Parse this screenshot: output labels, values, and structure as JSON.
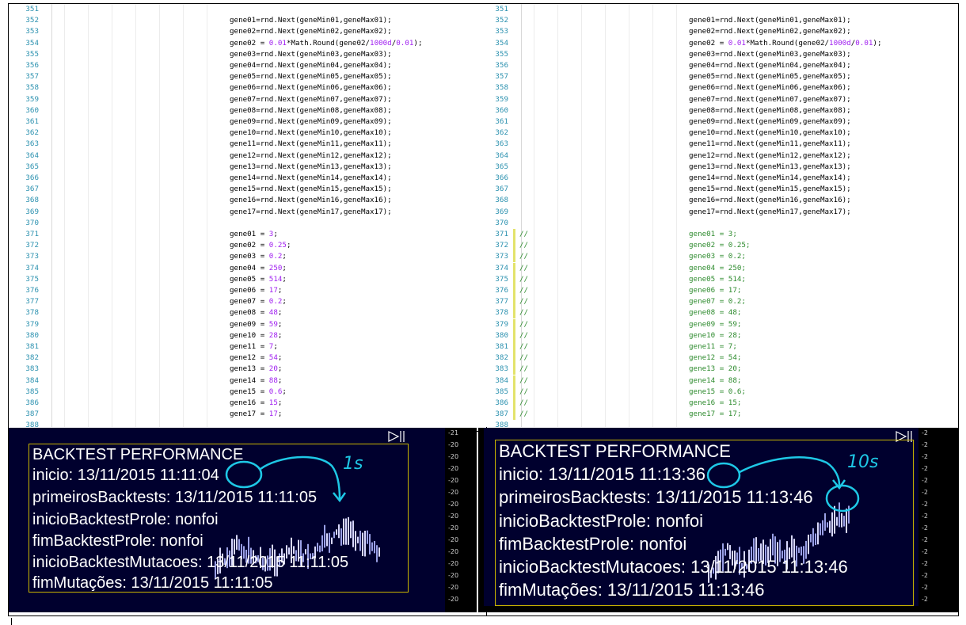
{
  "left_code": {
    "line_numbers": [
      "351",
      "352",
      "353",
      "354",
      "355",
      "356",
      "357",
      "358",
      "359",
      "360",
      "361",
      "362",
      "363",
      "364",
      "365",
      "366",
      "367",
      "368",
      "369",
      "370",
      "371",
      "372",
      "373",
      "374",
      "375",
      "376",
      "377",
      "378",
      "379",
      "380",
      "381",
      "382",
      "383",
      "384",
      "385",
      "386",
      "387",
      "388"
    ],
    "lines": [
      "",
      "gene01=rnd.Next(geneMin01,geneMax01);",
      "gene02=rnd.Next(geneMin02,geneMax02);",
      "gene02 = 0.01*Math.Round(gene02/1000d/0.01);",
      "gene03=rnd.Next(geneMin03,geneMax03);",
      "gene04=rnd.Next(geneMin04,geneMax04);",
      "gene05=rnd.Next(geneMin05,geneMax05);",
      "gene06=rnd.Next(geneMin06,geneMax06);",
      "gene07=rnd.Next(geneMin07,geneMax07);",
      "gene08=rnd.Next(geneMin08,geneMax08);",
      "gene09=rnd.Next(geneMin09,geneMax09);",
      "gene10=rnd.Next(geneMin10,geneMax10);",
      "gene11=rnd.Next(geneMin11,geneMax11);",
      "gene12=rnd.Next(geneMin12,geneMax12);",
      "gene13=rnd.Next(geneMin13,geneMax13);",
      "gene14=rnd.Next(geneMin14,geneMax14);",
      "gene15=rnd.Next(geneMin15,geneMax15);",
      "gene16=rnd.Next(geneMin16,geneMax16);",
      "gene17=rnd.Next(geneMin17,geneMax17);",
      "",
      "gene01 = 3;",
      "gene02 = 0.25;",
      "gene03 = 0.2;",
      "gene04 = 250;",
      "gene05 = 514;",
      "gene06 = 17;",
      "gene07 = 0.2;",
      "gene08 = 48;",
      "gene09 = 59;",
      "gene10 = 28;",
      "gene11 = 7;",
      "gene12 = 54;",
      "gene13 = 20;",
      "gene14 = 88;",
      "gene15 = 0.6;",
      "gene16 = 15;",
      "gene17 = 17;",
      ""
    ]
  },
  "right_code": {
    "line_numbers": [
      "351",
      "352",
      "353",
      "354",
      "355",
      "356",
      "357",
      "358",
      "359",
      "360",
      "361",
      "362",
      "363",
      "364",
      "365",
      "366",
      "367",
      "368",
      "369",
      "370",
      "371",
      "372",
      "373",
      "374",
      "375",
      "376",
      "377",
      "378",
      "379",
      "380",
      "381",
      "382",
      "383",
      "384",
      "385",
      "386",
      "387",
      "388"
    ],
    "comment_marker": "//",
    "commented_from_line": 20,
    "commented_to_line": 36,
    "lines": [
      "",
      "gene01=rnd.Next(geneMin01,geneMax01);",
      "gene02=rnd.Next(geneMin02,geneMax02);",
      "gene02 = 0.01*Math.Round(gene02/1000d/0.01);",
      "gene03=rnd.Next(geneMin03,geneMax03);",
      "gene04=rnd.Next(geneMin04,geneMax04);",
      "gene05=rnd.Next(geneMin05,geneMax05);",
      "gene06=rnd.Next(geneMin06,geneMax06);",
      "gene07=rnd.Next(geneMin07,geneMax07);",
      "gene08=rnd.Next(geneMin08,geneMax08);",
      "gene09=rnd.Next(geneMin09,geneMax09);",
      "gene10=rnd.Next(geneMin10,geneMax10);",
      "gene11=rnd.Next(geneMin11,geneMax11);",
      "gene12=rnd.Next(geneMin12,geneMax12);",
      "gene13=rnd.Next(geneMin13,geneMax13);",
      "gene14=rnd.Next(geneMin14,geneMax14);",
      "gene15=rnd.Next(geneMin15,geneMax15);",
      "gene16=rnd.Next(geneMin16,geneMax16);",
      "gene17=rnd.Next(geneMin17,geneMax17);",
      "",
      "gene01 = 3;",
      "gene02 = 0.25;",
      "gene03 = 0.2;",
      "gene04 = 250;",
      "gene05 = 514;",
      "gene06 = 17;",
      "gene07 = 0.2;",
      "gene08 = 48;",
      "gene09 = 59;",
      "gene10 = 28;",
      "gene11 = 7;",
      "gene12 = 54;",
      "gene13 = 20;",
      "gene14 = 88;",
      "gene15 = 0.6;",
      "gene16 = 15;",
      "gene17 = 17;",
      ""
    ]
  },
  "left_panel": {
    "title": "BACKTEST PERFORMANCE",
    "lines": [
      "inicio: 13/11/2015 11:11:04",
      "primeirosBacktests: 13/11/2015 11:11:05",
      "inicioBacktestProle: nonfoi",
      "fimBacktestProle: nonfoi",
      "inicioBacktestMutacoes: 13/11/2015 11:11:05",
      "fimMutações: 13/11/2015 11:11:05"
    ],
    "annotation": "1s",
    "axis_ticks": [
      "21",
      "20",
      "20",
      "20",
      "20",
      "20",
      "20",
      "20",
      "20",
      "20",
      "20",
      "20",
      "20",
      "20",
      "20"
    ]
  },
  "right_panel": {
    "title": "BACKTEST PERFORMANCE",
    "lines": [
      "inicio: 13/11/2015 11:13:36",
      "primeirosBacktests: 13/11/2015 11:13:46",
      "inicioBacktestProle: nonfoi",
      "fimBacktestProle: nonfoi",
      "inicioBacktestMutacoes: 13/11/2015 11:13:46",
      "fimMutações: 13/11/2015 11:13:46"
    ],
    "annotation": "10s",
    "axis_ticks": [
      "2",
      "2",
      "2",
      "2",
      "2",
      "2",
      "2",
      "2",
      "2",
      "2",
      "2",
      "2",
      "2",
      "2",
      "2"
    ]
  },
  "colors": {
    "line_number": "#2b91af",
    "number_literal": "#a020f0",
    "comment": "#2e8b2e",
    "chart_bg": "#00002e",
    "panel_border": "#c8b400",
    "annotation": "#1ec8e6"
  }
}
